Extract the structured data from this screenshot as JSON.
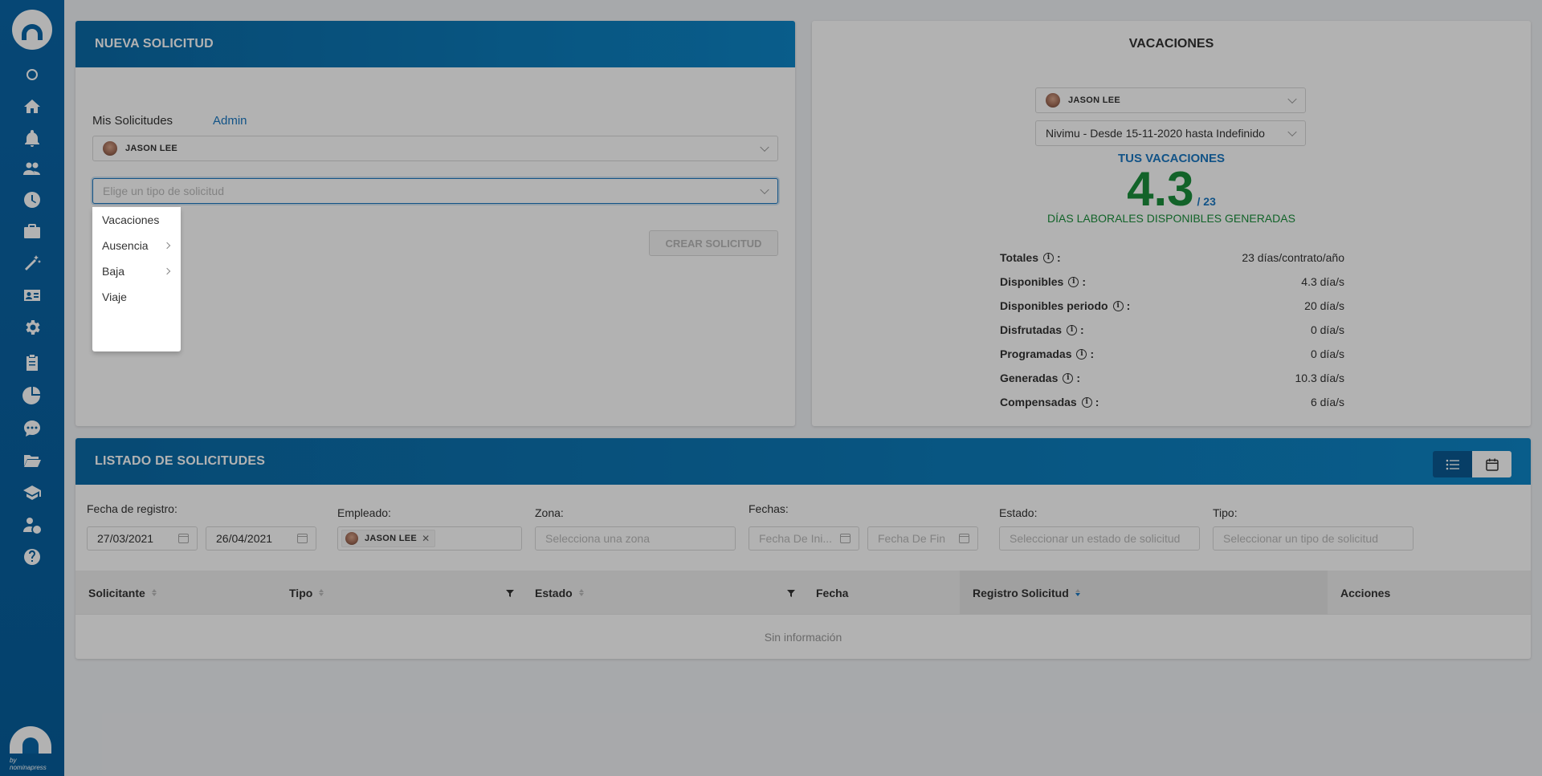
{
  "sidebar": {
    "icons": [
      "home-icon",
      "bell-icon",
      "users-icon",
      "clock-icon",
      "briefcase-icon",
      "magic-icon",
      "id-card-icon",
      "gear-icon",
      "clipboard-icon",
      "pie-chart-icon",
      "chat-icon",
      "folder-icon",
      "graduation-icon",
      "user-money-icon",
      "help-icon"
    ],
    "brand": "by nominapress"
  },
  "nueva_solicitud": {
    "title": "NUEVA SOLICITUD",
    "tabs": [
      {
        "label": "Mis Solicitudes"
      },
      {
        "label": "Admin"
      }
    ],
    "active_tab": "Admin",
    "employee": "JASON LEE",
    "type_placeholder": "Elige un tipo de solicitud",
    "create_button": "CREAR SOLICITUD",
    "dropdown_options": [
      {
        "label": "Vacaciones",
        "has_submenu": false
      },
      {
        "label": "Ausencia",
        "has_submenu": true
      },
      {
        "label": "Baja",
        "has_submenu": true
      },
      {
        "label": "Viaje",
        "has_submenu": false
      }
    ]
  },
  "vacaciones": {
    "title": "VACACIONES",
    "employee": "JASON LEE",
    "period": "Nivimu - Desde 15-11-2020 hasta Indefinido",
    "tus_label": "TUS VACACIONES",
    "available": "4.3",
    "total": "/ 23",
    "subtitle": "DÍAS LABORALES DISPONIBLES GENERADAS",
    "stats": [
      {
        "label": "Totales",
        "value": "23 días/contrato/año"
      },
      {
        "label": "Disponibles",
        "value": "4.3 día/s"
      },
      {
        "label": "Disponibles periodo",
        "value": "20 día/s"
      },
      {
        "label": "Disfrutadas",
        "value": "0 día/s"
      },
      {
        "label": "Programadas",
        "value": "0 día/s"
      },
      {
        "label": "Generadas",
        "value": "10.3 día/s"
      },
      {
        "label": "Compensadas",
        "value": "6 día/s"
      }
    ]
  },
  "listado": {
    "title": "LISTADO DE SOLICITUDES",
    "filters": {
      "fecha_registro_label": "Fecha de registro:",
      "fecha_desde": "27/03/2021",
      "fecha_hasta": "26/04/2021",
      "empleado_label": "Empleado:",
      "empleado_tag": "JASON LEE",
      "zona_label": "Zona:",
      "zona_placeholder": "Selecciona una zona",
      "fechas_label": "Fechas:",
      "fecha_inicio_placeholder": "Fecha De Ini...",
      "fecha_fin_placeholder": "Fecha De Fin",
      "estado_label": "Estado:",
      "estado_placeholder": "Seleccionar un estado de solicitud",
      "tipo_label": "Tipo:",
      "tipo_placeholder": "Seleccionar un tipo de solicitud"
    },
    "columns": [
      "Solicitante",
      "Tipo",
      "Estado",
      "Fecha",
      "Registro Solicitud",
      "Acciones"
    ],
    "empty_text": "Sin información"
  }
}
